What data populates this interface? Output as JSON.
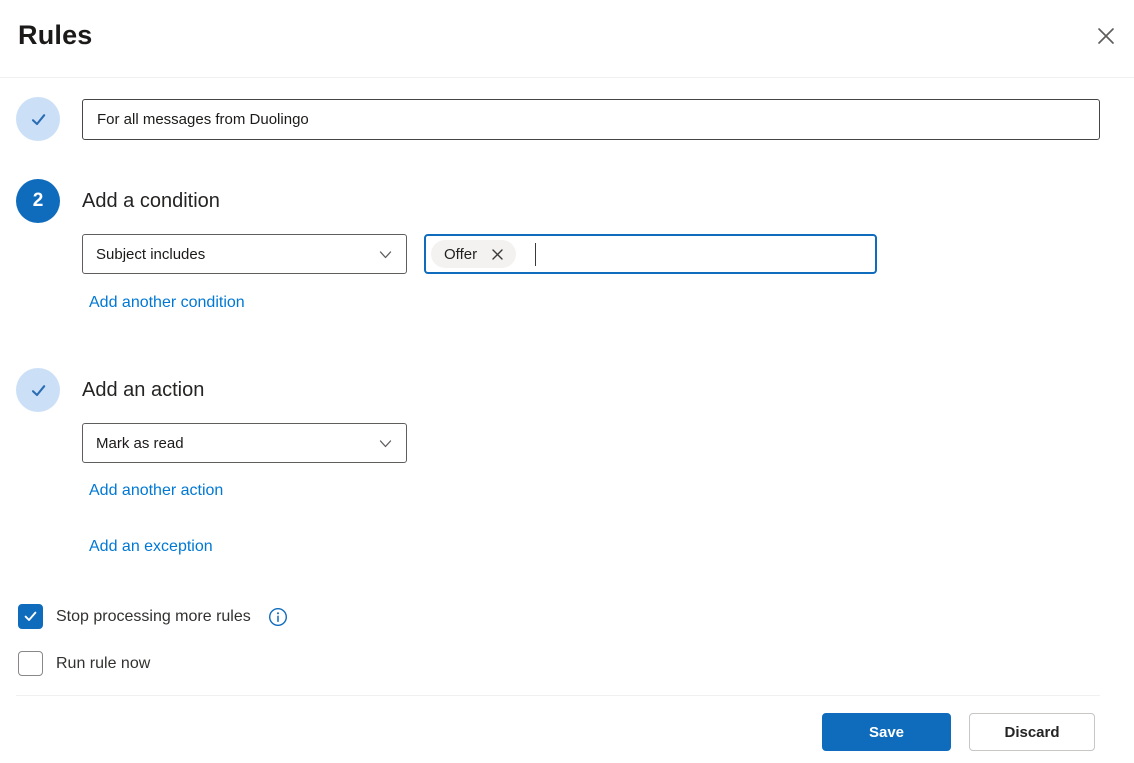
{
  "dialog": {
    "title": "Rules"
  },
  "icons": {
    "close": "close-icon",
    "chevron": "chevron-down-icon",
    "check": "check-icon",
    "dismiss": "dismiss-icon",
    "info": "info-icon"
  },
  "colors": {
    "accent": "#0f6cbd",
    "link": "#0078d4",
    "step_complete_bg": "#cbe0f7",
    "step_complete_check": "#2b6cb3",
    "divider": "#f0f0f0"
  },
  "steps": {
    "name": {
      "status": "complete",
      "input_value": "For all messages from Duolingo"
    },
    "condition": {
      "number": "2",
      "heading": "Add a condition",
      "dropdown_value": "Subject includes",
      "tags": [
        {
          "label": "Offer"
        }
      ],
      "add_link": "Add another condition"
    },
    "action": {
      "status": "complete",
      "heading": "Add an action",
      "dropdown_value": "Mark as read",
      "add_link": "Add another action",
      "exception_link": "Add an exception"
    }
  },
  "options": {
    "stop_processing": {
      "label": "Stop processing more rules",
      "checked": true
    },
    "run_now": {
      "label": "Run rule now",
      "checked": false
    }
  },
  "footer": {
    "save_label": "Save",
    "discard_label": "Discard"
  }
}
